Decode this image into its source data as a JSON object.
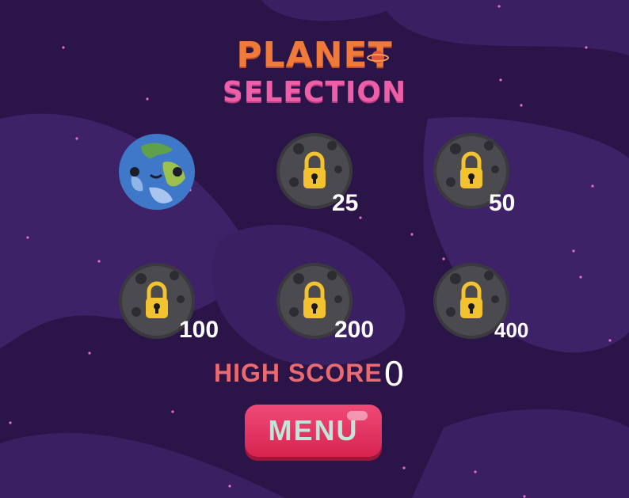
{
  "title": {
    "line1": "PLANET",
    "line2": "SELECTION"
  },
  "planets": [
    {
      "name": "earth",
      "unlocked": true,
      "cost": ""
    },
    {
      "name": "moon",
      "unlocked": false,
      "cost": "25"
    },
    {
      "name": "moon",
      "unlocked": false,
      "cost": "50"
    },
    {
      "name": "moon",
      "unlocked": false,
      "cost": "100"
    },
    {
      "name": "moon",
      "unlocked": false,
      "cost": "200"
    },
    {
      "name": "moon",
      "unlocked": false,
      "cost": "400"
    }
  ],
  "high_score": {
    "label": "HIGH SCORE",
    "value": "0"
  },
  "menu_button": {
    "label": "MENU"
  },
  "colors": {
    "background": "#2a1547",
    "title1": "#f07a3a",
    "title2": "#ee5fa7",
    "button": "#e23a62",
    "lock": "#f2c230"
  }
}
